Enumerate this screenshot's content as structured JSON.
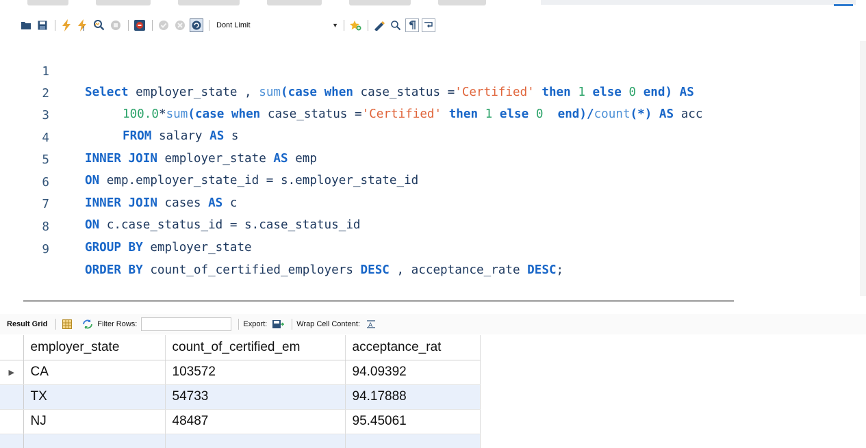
{
  "toolbar": {
    "limit_label": "Dont Limit",
    "icons": [
      "folder-icon",
      "save-icon",
      "execute-icon",
      "execute-current-icon",
      "explain-icon",
      "stop-icon",
      "toggle-error-icon",
      "commit-icon",
      "rollback-icon",
      "autocommit-icon",
      "bookmark-icon",
      "beautify-icon",
      "find-icon",
      "invisible-chars-icon",
      "wrap-icon"
    ]
  },
  "editor": {
    "lines": [
      {
        "n": "1"
      },
      {
        "n": "2"
      },
      {
        "n": "3"
      },
      {
        "n": "4"
      },
      {
        "n": "5"
      },
      {
        "n": "6"
      },
      {
        "n": "7"
      },
      {
        "n": "8"
      },
      {
        "n": "9"
      }
    ],
    "tokens": {
      "l1": [
        "Select",
        " employer_state , ",
        "sum",
        "(",
        "case",
        " ",
        "when",
        " case_status =",
        "'Certified'",
        " ",
        "then",
        " ",
        "1",
        " ",
        "else",
        " ",
        "0",
        " ",
        "end",
        ") ",
        "AS"
      ],
      "l2": [
        "100.0",
        "*",
        "sum",
        "(",
        "case",
        " ",
        "when",
        " case_status =",
        "'Certified'",
        " ",
        "then",
        " ",
        "1",
        " ",
        "else",
        " ",
        "0",
        "  ",
        "end",
        ")/",
        "count",
        "(*) ",
        "AS",
        " acc"
      ],
      "l3": [
        "FROM",
        " salary ",
        "AS",
        " s"
      ],
      "l4": [
        "INNER JOIN",
        " employer_state ",
        "AS",
        " emp"
      ],
      "l5": [
        "ON",
        " emp.employer_state_id = s.employer_state_id"
      ],
      "l6": [
        "INNER JOIN",
        " cases ",
        "AS",
        " c"
      ],
      "l7": [
        "ON",
        " c.case_status_id = s.case_status_id"
      ],
      "l8": [
        "GROUP BY",
        " employer_state"
      ],
      "l9": [
        "ORDER BY",
        " count_of_certified_employers ",
        "DESC",
        " , acceptance_rate ",
        "DESC",
        ";"
      ]
    }
  },
  "result_toolbar": {
    "result_grid_label": "Result Grid",
    "filter_label": "Filter Rows:",
    "filter_value": "",
    "export_label": "Export:",
    "wrap_label": "Wrap Cell Content:"
  },
  "grid": {
    "columns": [
      "employer_state",
      "count_of_certified_em",
      "acceptance_rat"
    ],
    "rows": [
      [
        "CA",
        "103572",
        "94.09392"
      ],
      [
        "TX",
        "54733",
        "94.17888"
      ],
      [
        "NJ",
        "48487",
        "95.45061"
      ]
    ]
  }
}
